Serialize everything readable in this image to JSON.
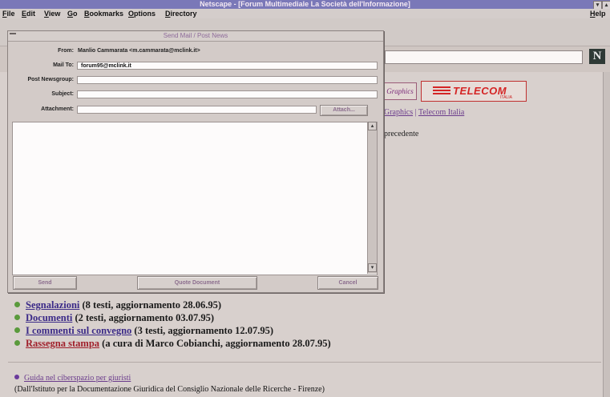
{
  "window": {
    "title": "Netscape - [Forum Multimediale La Società dell'Informazione]",
    "controls": [
      "▾",
      "▴"
    ]
  },
  "menu": {
    "items": [
      "File",
      "Edit",
      "View",
      "Go",
      "Bookmarks",
      "Options",
      "Directory"
    ],
    "help": "Help"
  },
  "logo": {
    "letter": "N"
  },
  "dialog": {
    "title": "Send Mail / Post News",
    "from_label": "From:",
    "from_value": "Manlio Cammarata <m.cammarata@mclink.it>",
    "mailto_label": "Mail To:",
    "mailto_value": "forum95@mclink.it",
    "newsgroup_label": "Post Newsgroup:",
    "newsgroup_value": "",
    "subject_label": "Subject:",
    "subject_value": "",
    "attachment_label": "Attachment:",
    "attachment_value": "",
    "attach_button": "Attach...",
    "send_button": "Send",
    "quote_button": "Quote Document",
    "cancel_button": "Cancel",
    "body_text": ""
  },
  "page": {
    "sponsor_graphics": "Graphics",
    "telecom_logo": "TELECOM",
    "telecom_sub": "ITALIA",
    "links_line": [
      "Graphics",
      "Telecom Italia"
    ],
    "links_separator": " | ",
    "prev_text": "precedente",
    "items": [
      {
        "link": "Segnalazioni",
        "text": " (8 testi, aggiornamento 28.06.95)"
      },
      {
        "link": "Documenti",
        "text": " (2 testi, aggiornamento 03.07.95)"
      },
      {
        "link": "I commenti sul convegno",
        "text": " (3 testi, aggiornamento 12.07.95)"
      },
      {
        "link": "Rassegna stampa",
        "text": " (a cura di Marco Cobianchi, aggiornamento 28.07.95)"
      }
    ],
    "guide_link": "Guida nel ciberspazio per giuristi",
    "footer": "(Dall'Istituto per la Documentazione Giuridica del Consiglio Nazionale delle Ricerche - Firenze)"
  },
  "colors": {
    "titlebar": "#7a78b8",
    "link": "#3b2a88",
    "link_red": "#a01f2a",
    "bullet": "#5a9a3c",
    "telecom_red": "#d42525"
  }
}
